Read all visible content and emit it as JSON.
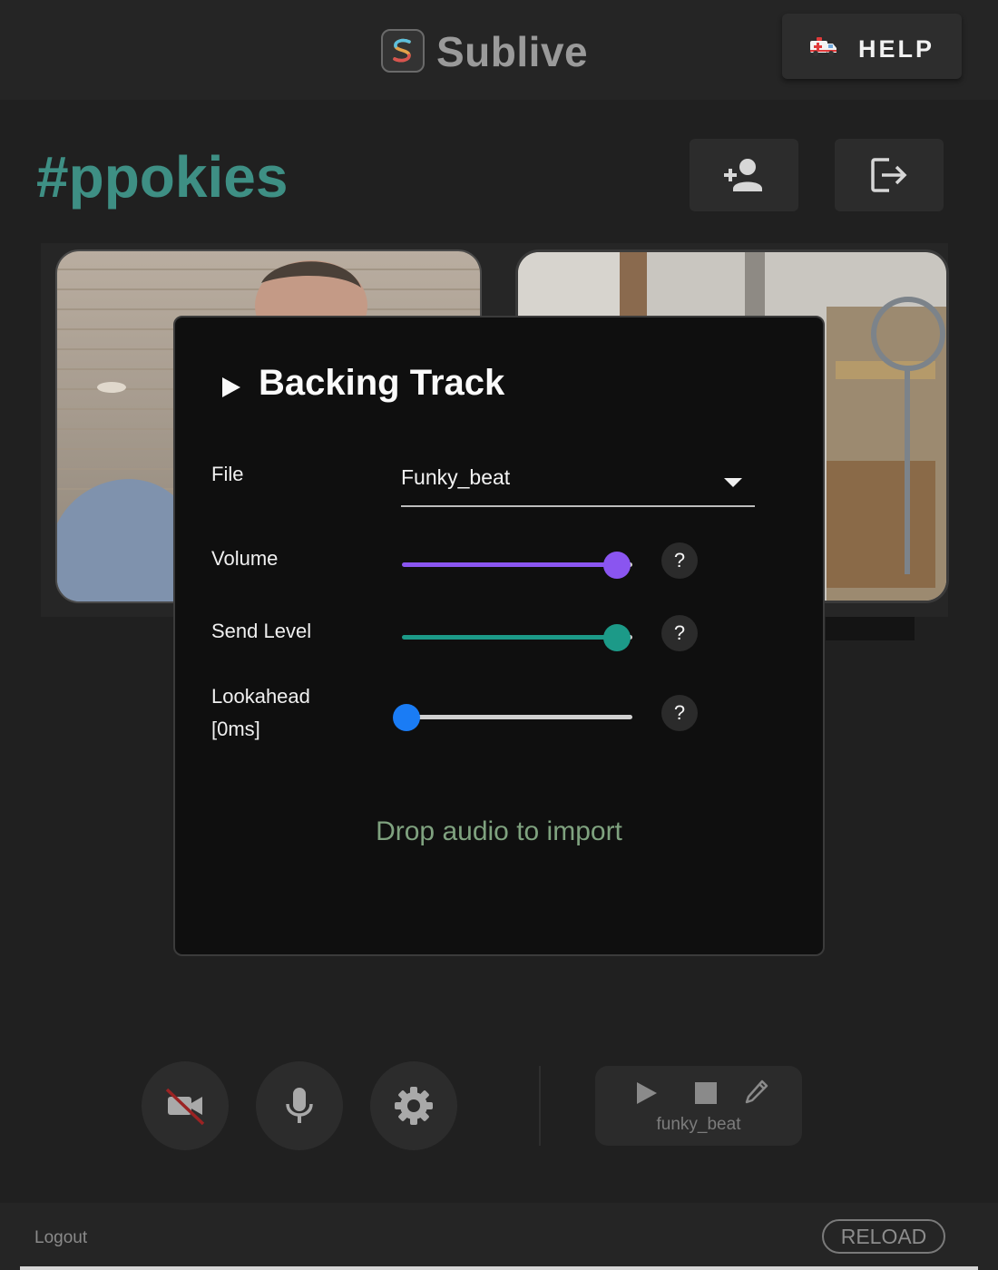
{
  "header": {
    "app_title": "Sublive",
    "help_label": "HELP"
  },
  "room": {
    "channel": "#ppokies"
  },
  "modal": {
    "title": "Backing Track",
    "file_label": "File",
    "file_value": "Funky_beat",
    "volume_label": "Volume",
    "volume_level": 0.95,
    "send_level_label": "Send Level",
    "send_level": 0.95,
    "lookahead_label": "Lookahead",
    "lookahead_value_label": "[0ms]",
    "lookahead_level": 0.0,
    "help_symbol": "?",
    "drop_hint": "Drop audio to import"
  },
  "player": {
    "track_name": "funky_beat"
  },
  "footer": {
    "logout_label": "Logout",
    "reload_label": "RELOAD"
  },
  "colors": {
    "channel": "#3e8f84",
    "volume_accent": "#8a55f0",
    "send_accent": "#1c9a88",
    "lookahead_accent": "#1a7cf5",
    "drop_hint": "#7fa27f"
  }
}
